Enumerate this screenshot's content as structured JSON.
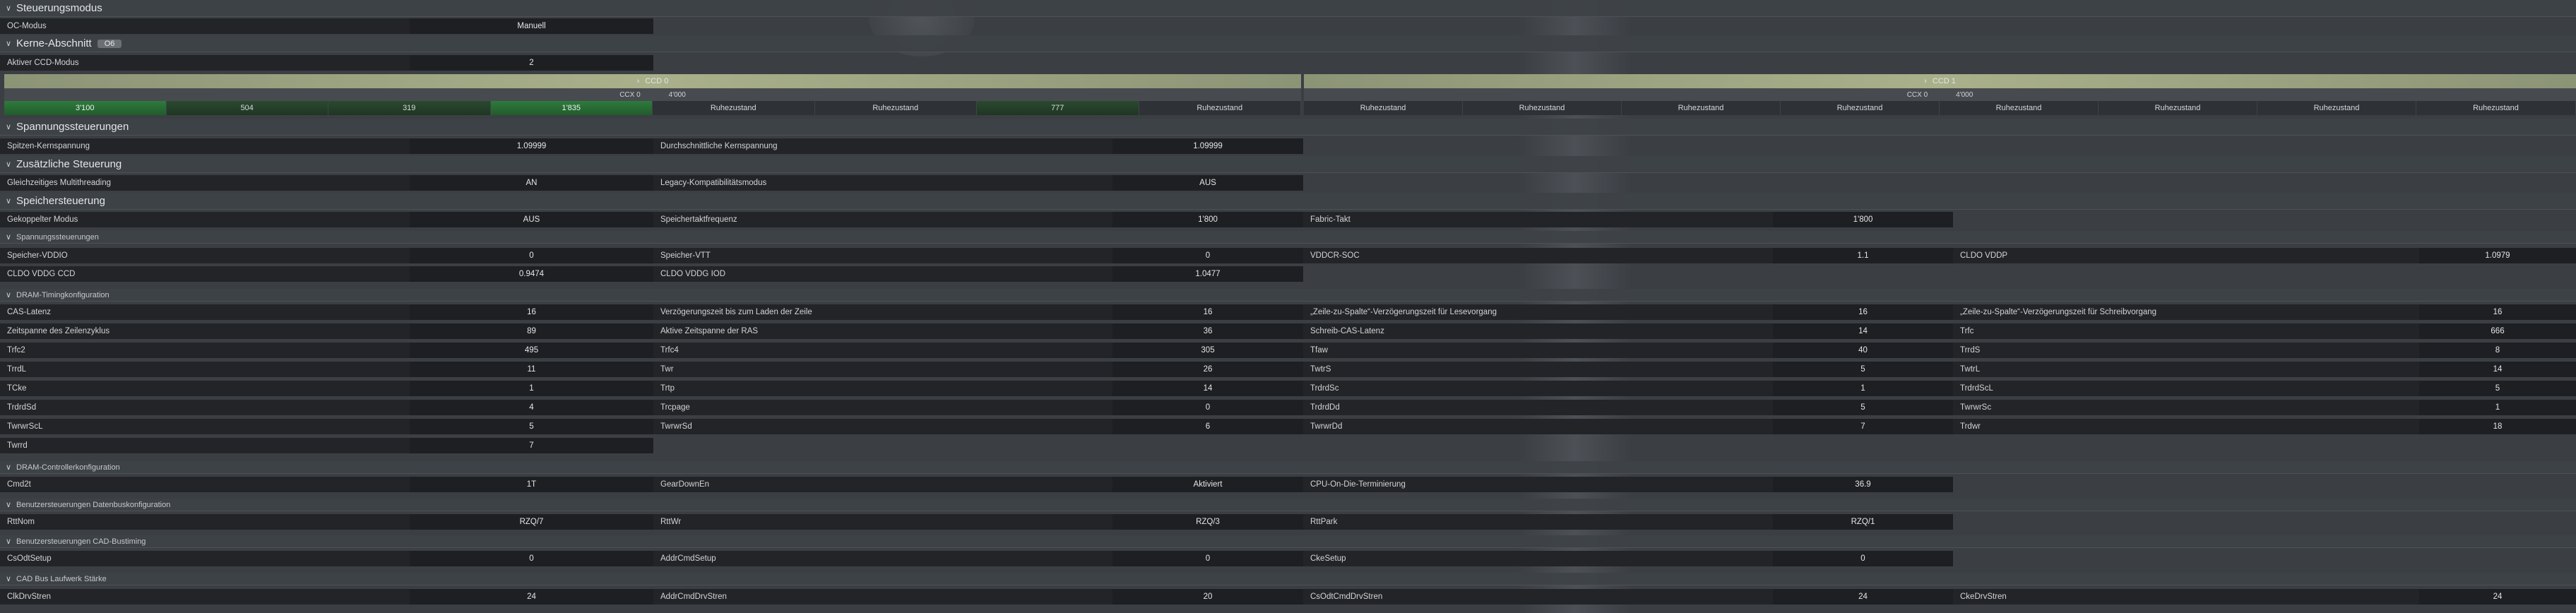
{
  "sections": {
    "steuerungsmodus": "Steuerungsmodus",
    "kerne": "Kerne-Abschnitt",
    "kerne_badge": "O6",
    "spannung": "Spannungssteuerungen",
    "zusaetzlich": "Zusätzliche Steuerung",
    "speicher": "Speichersteuerung",
    "sub_spannung": "Spannungssteuerungen",
    "sub_dram_timing": "DRAM-Timingkonfiguration",
    "sub_dram_controller": "DRAM-Controllerkonfiguration",
    "sub_datenbus": "Benutzersteuerungen Datenbuskonfiguration",
    "sub_cad_bustiming": "Benutzersteuerungen CAD-Bustiming",
    "sub_cad_bus_staerke": "CAD Bus Laufwerk Stärke"
  },
  "oc": {
    "label": "OC-Modus",
    "value": "Manuell"
  },
  "ccd_mode": {
    "label": "Aktiver CCD-Modus",
    "value": "2"
  },
  "ccd0": {
    "title": "CCD 0",
    "ccx": "CCX 0",
    "freq": "4'000",
    "cores": [
      "3'100",
      "504",
      "319",
      "1'835",
      "Ruhezustand",
      "Ruhezustand",
      "777",
      "Ruhezustand"
    ]
  },
  "ccd1": {
    "title": "CCD 1",
    "ccx": "CCX 0",
    "freq": "4'000",
    "cores": [
      "Ruhezustand",
      "Ruhezustand",
      "Ruhezustand",
      "Ruhezustand",
      "Ruhezustand",
      "Ruhezustand",
      "Ruhezustand",
      "Ruhezustand"
    ]
  },
  "voltage": {
    "peak_label": "Spitzen-Kernspannung",
    "peak_value": "1.09999",
    "avg_label": "Durchschnittliche Kernspannung",
    "avg_value": "1.09999"
  },
  "extra": {
    "smt_label": "Gleichzeitiges Multithreading",
    "smt_value": "AN",
    "legacy_label": "Legacy-Kompatibilitätsmodus",
    "legacy_value": "AUS"
  },
  "mem": {
    "r1": [
      {
        "label": "Gekoppelter Modus",
        "value": "AUS"
      },
      {
        "label": "Speichertaktfrequenz",
        "value": "1'800"
      },
      {
        "label": "Fabric-Takt",
        "value": "1'800"
      }
    ]
  },
  "volt_rows": [
    [
      {
        "label": "Speicher-VDDIO",
        "value": "0"
      },
      {
        "label": "Speicher-VTT",
        "value": "0"
      },
      {
        "label": "VDDCR-SOC",
        "value": "1.1"
      },
      {
        "label": "CLDO VDDP",
        "value": "1.0979"
      }
    ],
    [
      {
        "label": "CLDO VDDG CCD",
        "value": "0.9474"
      },
      {
        "label": "CLDO VDDG IOD",
        "value": "1.0477"
      }
    ]
  ],
  "timing_rows": [
    [
      {
        "label": "CAS-Latenz",
        "value": "16"
      },
      {
        "label": "Verzögerungszeit bis zum Laden der Zeile",
        "value": "16"
      },
      {
        "label": "„Zeile-zu-Spalte“-Verzögerungszeit für Lesevorgang",
        "value": "16"
      },
      {
        "label": "„Zeile-zu-Spalte“-Verzögerungszeit für Schreibvorgang",
        "value": "16"
      }
    ],
    [
      {
        "label": "Zeitspanne des Zeilenzyklus",
        "value": "89"
      },
      {
        "label": "Aktive Zeitspanne der RAS",
        "value": "36"
      },
      {
        "label": "Schreib-CAS-Latenz",
        "value": "14"
      },
      {
        "label": "Trfc",
        "value": "666"
      }
    ],
    [
      {
        "label": "Trfc2",
        "value": "495"
      },
      {
        "label": "Trfc4",
        "value": "305"
      },
      {
        "label": "Tfaw",
        "value": "40"
      },
      {
        "label": "TrrdS",
        "value": "8"
      }
    ],
    [
      {
        "label": "TrrdL",
        "value": "11"
      },
      {
        "label": "Twr",
        "value": "26"
      },
      {
        "label": "TwtrS",
        "value": "5"
      },
      {
        "label": "TwtrL",
        "value": "14"
      }
    ],
    [
      {
        "label": "TCke",
        "value": "1"
      },
      {
        "label": "Trtp",
        "value": "14"
      },
      {
        "label": "TrdrdSc",
        "value": "1"
      },
      {
        "label": "TrdrdScL",
        "value": "5"
      }
    ],
    [
      {
        "label": "TrdrdSd",
        "value": "4"
      },
      {
        "label": "Trcpage",
        "value": "0"
      },
      {
        "label": "TrdrdDd",
        "value": "5"
      },
      {
        "label": "TwrwrSc",
        "value": "1"
      }
    ],
    [
      {
        "label": "TwrwrScL",
        "value": "5"
      },
      {
        "label": "TwrwrSd",
        "value": "6"
      },
      {
        "label": "TwrwrDd",
        "value": "7"
      },
      {
        "label": "Trdwr",
        "value": "18"
      }
    ],
    [
      {
        "label": "Twrrd",
        "value": "7"
      }
    ]
  ],
  "controller_row": [
    {
      "label": "Cmd2t",
      "value": "1T"
    },
    {
      "label": "GearDownEn",
      "value": "Aktiviert"
    },
    {
      "label": "CPU-On-Die-Terminierung",
      "value": "36.9"
    }
  ],
  "databus_row": [
    {
      "label": "RttNom",
      "value": "RZQ/7"
    },
    {
      "label": "RttWr",
      "value": "RZQ/3"
    },
    {
      "label": "RttPark",
      "value": "RZQ/1"
    }
  ],
  "cad_timing_row": [
    {
      "label": "CsOdtSetup",
      "value": "0"
    },
    {
      "label": "AddrCmdSetup",
      "value": "0"
    },
    {
      "label": "CkeSetup",
      "value": "0"
    }
  ],
  "cad_strength_row": [
    {
      "label": "ClkDrvStren",
      "value": "24"
    },
    {
      "label": "AddrCmdDrvStren",
      "value": "20"
    },
    {
      "label": "CsOdtCmdDrvStren",
      "value": "24"
    },
    {
      "label": "CkeDrvStren",
      "value": "24"
    }
  ]
}
